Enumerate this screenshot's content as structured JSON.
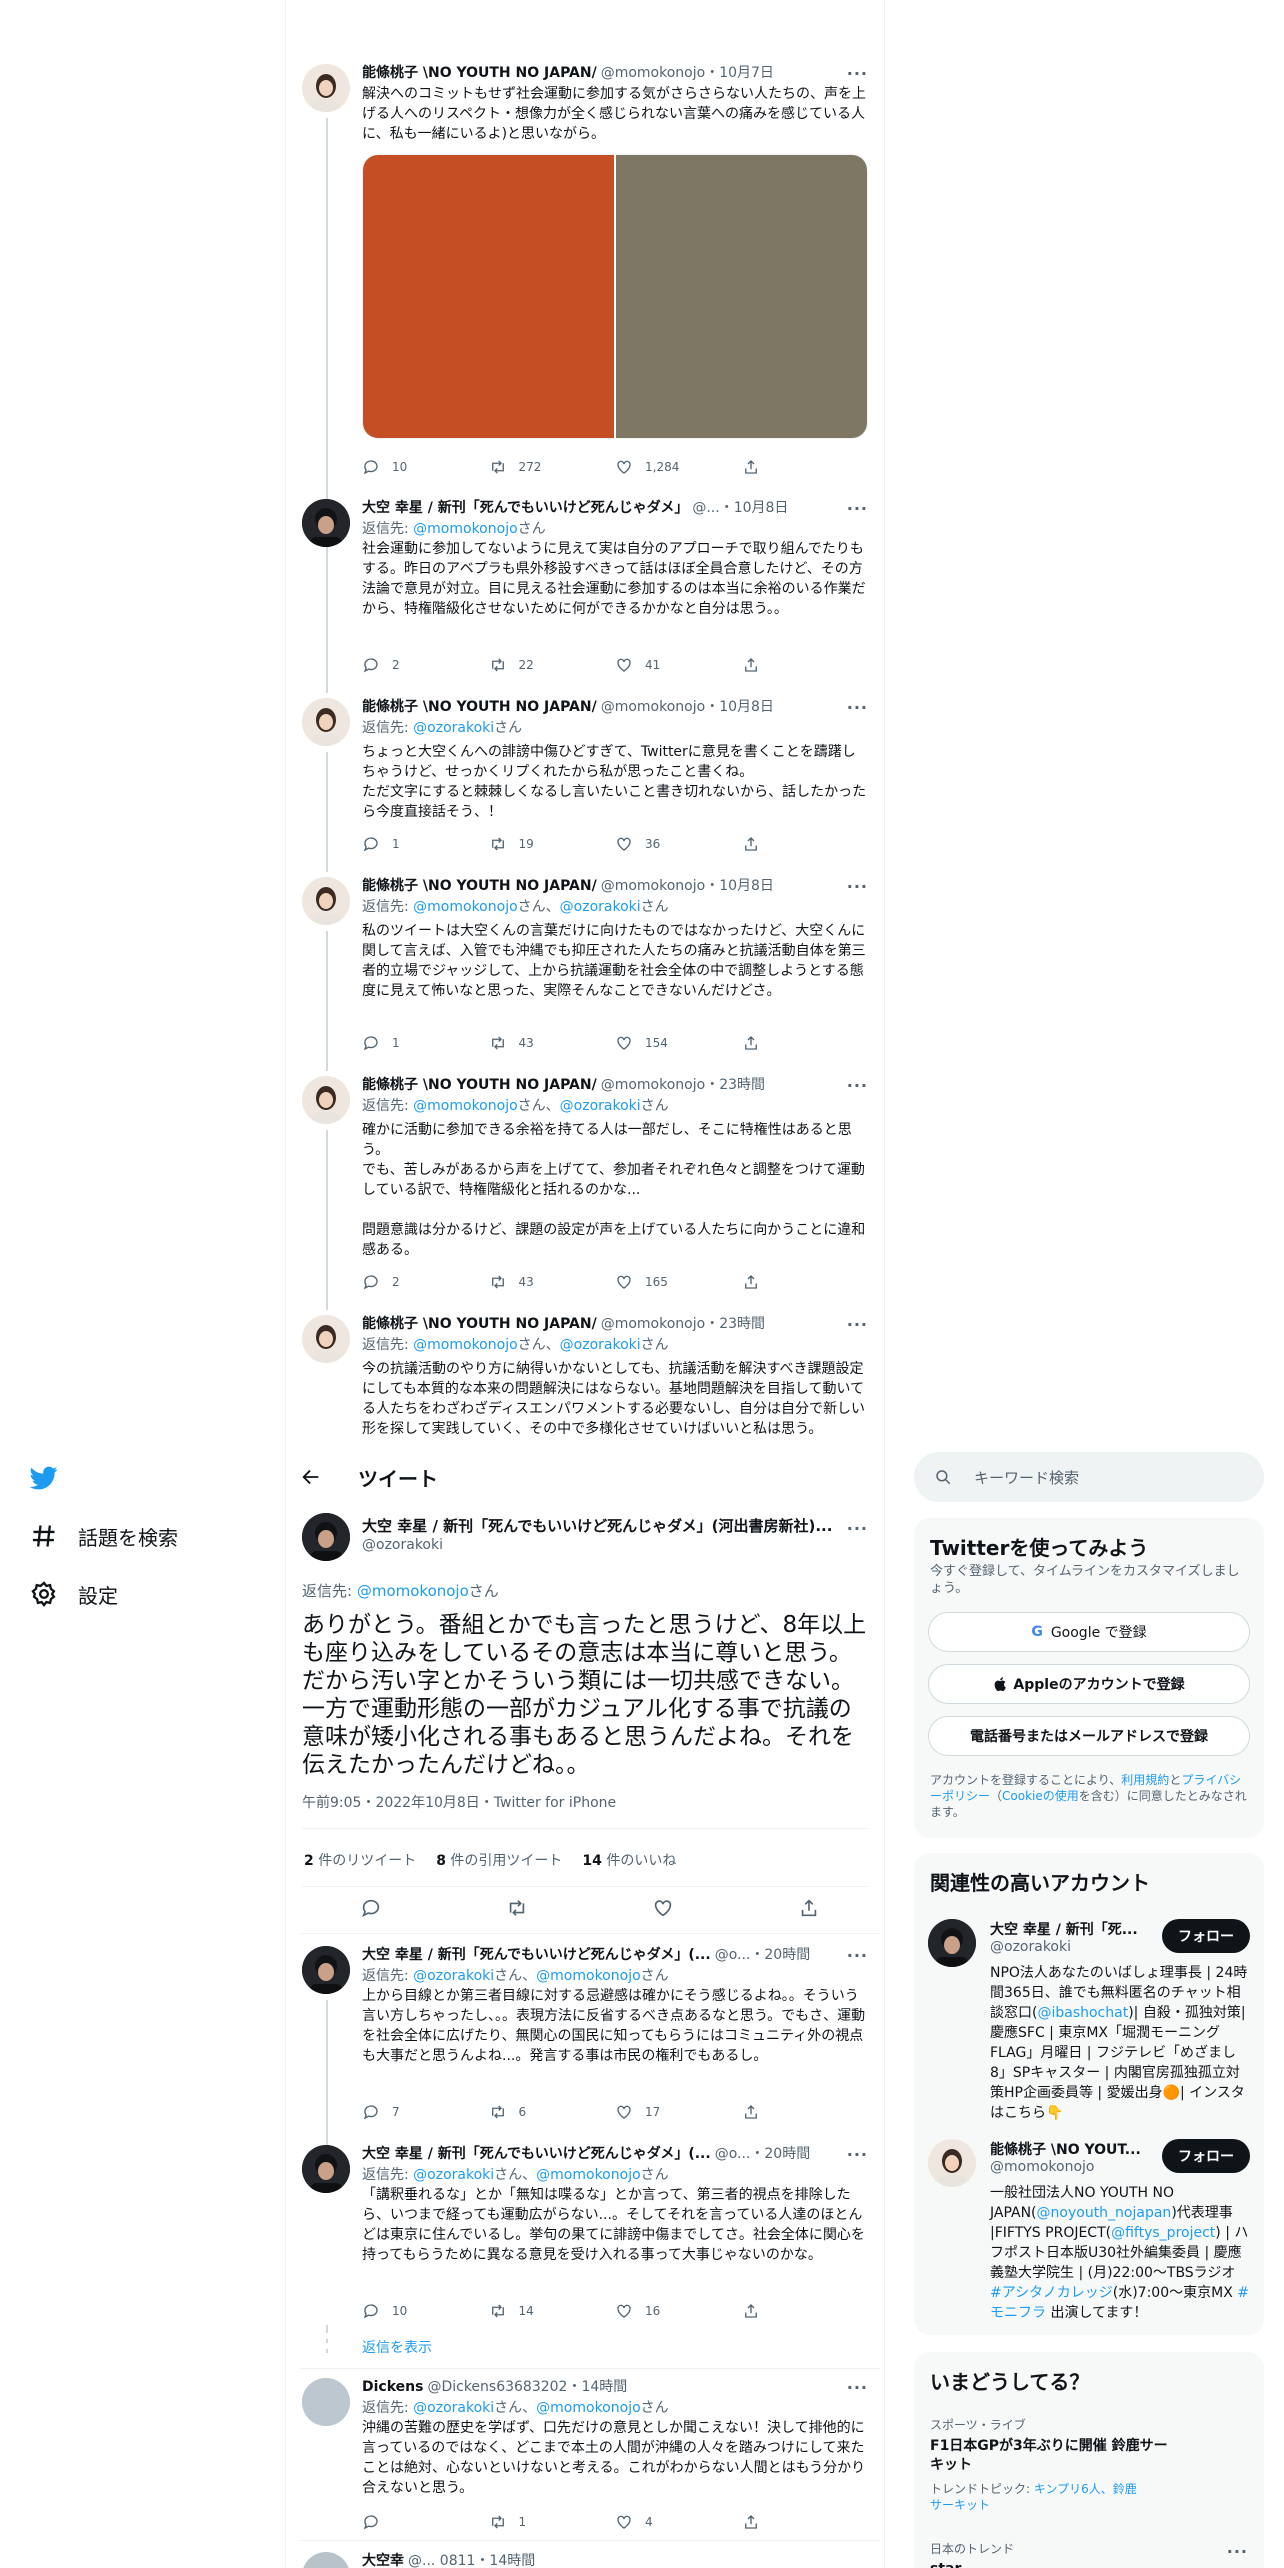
{
  "colors": {
    "accent": "#1d9bf0",
    "text": "#0f1419",
    "muted": "#536471",
    "divider": "#eff3f4",
    "panel": "#f7f9f9",
    "img_left": "#c64e25",
    "img_right": "#7e7764"
  },
  "nav": {
    "items": [
      {
        "icon": "twitter-logo-icon",
        "label": ""
      },
      {
        "icon": "hashtag-icon",
        "label": "話題を検索"
      },
      {
        "icon": "gear-icon",
        "label": "設定"
      }
    ]
  },
  "header": {
    "back_icon": "arrow-left-icon",
    "title": "ツイート"
  },
  "search": {
    "placeholder": "キーワード検索",
    "icon": "search-icon"
  },
  "ancestors": [
    {
      "name": "能條桃子 \\NO YOUTH NO JAPAN/",
      "handle": "@momokonojo",
      "time": "・10月7日",
      "reply": "",
      "reply_to": [],
      "text": "解決へのコミットもせず社会運動に参加する気がさらさらない人たちの、声を上げる人へのリスペクト・想像力が全く感じられない言葉への痛みを感じている人に、私も一緒にいるよ)と思いながら。",
      "replies": "10",
      "retweets": "272",
      "likes": "1,284"
    },
    {
      "name": "大空 幸星 / 新刊「死んでもいいけど死んじゃダメ」",
      "handle": "@...",
      "time": "・10月8日",
      "reply": "返信先:",
      "reply_to": [
        "@momokonojo"
      ],
      "text": "社会運動に参加してないように見えて実は自分のアプローチで取り組んでたりもする。昨日のアベプラも県外移設すべきって話はほぼ全員合意したけど、その方法論で意見が対立。目に見える社会運動に参加するのは本当に余裕のいる作業だから、特権階級化させないために何ができるかかなと自分は思う。。",
      "replies": "2",
      "retweets": "22",
      "likes": "41"
    },
    {
      "name": "能條桃子 \\NO YOUTH NO JAPAN/",
      "handle": "@momokonojo",
      "time": "・10月8日",
      "reply": "返信先:",
      "reply_to": [
        "@ozorakoki"
      ],
      "text": "ちょっと大空くんへの誹謗中傷ひどすぎて、Twitterに意見を書くことを躊躇しちゃうけど、せっかくリプくれたから私が思ったこと書くね。\nただ文字にすると棘棘しくなるし言いたいこと書き切れないから、話したかったら今度直接話そう、！",
      "replies": "1",
      "retweets": "19",
      "likes": "36"
    },
    {
      "name": "能條桃子 \\NO YOUTH NO JAPAN/",
      "handle": "@momokonojo",
      "time": "・10月8日",
      "reply": "返信先:",
      "reply_to": [
        "@momokonojo",
        "@ozorakoki"
      ],
      "text": "私のツイートは大空くんの言葉だけに向けたものではなかったけど、大空くんに関して言えば、入管でも沖縄でも抑圧された人たちの痛みと抗議活動自体を第三者的立場でジャッジして、上から抗議運動を社会全体の中で調整しようとする態度に見えて怖いなと思った、実際そんなことできないんだけどさ。",
      "replies": "1",
      "retweets": "43",
      "likes": "154"
    },
    {
      "name": "能條桃子 \\NO YOUTH NO JAPAN/",
      "handle": "@momokonojo",
      "time": "・23時間",
      "reply": "返信先:",
      "reply_to": [
        "@momokonojo",
        "@ozorakoki"
      ],
      "text": "確かに活動に参加できる余裕を持てる人は一部だし、そこに特権性はあると思う。\nでも、苦しみがあるから声を上げてて、参加者それぞれ色々と調整をつけて運動している訳で、特権階級化と括れるのかな...\n\n問題意識は分かるけど、課題の設定が声を上げている人たちに向かうことに違和感ある。",
      "replies": "2",
      "retweets": "43",
      "likes": "165"
    },
    {
      "name": "能條桃子 \\NO YOUTH NO JAPAN/",
      "handle": "@momokonojo",
      "time": "・23時間",
      "reply": "返信先:",
      "reply_to": [
        "@momokonojo",
        "@ozorakoki"
      ],
      "text": "今の抗議活動のやり方に納得いかないとしても、抗議活動を解決すべき課題設定にしても本質的な本来の問題解決にはならない。基地問題解決を目指して動いてる人たちをわざわざディスエンパワメントする必要ないし、自分は自分で新しい形を探して実践していく、その中で多様化させていけばいいと私は思う。",
      "replies": "",
      "retweets": "",
      "likes": ""
    }
  ],
  "main_tweet": {
    "name": "大空 幸星 / 新刊「死んでもいいけど死んじゃダメ」(河出書房新社)...",
    "handle": "@ozorakoki",
    "reply": "返信先:",
    "reply_to": "@momokonojo",
    "text": "ありがとう。番組とかでも言ったと思うけど、8年以上も座り込みをしているその意志は本当に尊いと思う。だから汚い字とかそういう類には一切共感できない。一方で運動形態の一部がカジュアル化する事で抗議の意味が矮小化される事もあると思うんだよね。それを伝えたかったんだけどね。。",
    "meta": "午前9:05・2022年10月8日・Twitter for iPhone",
    "retweets_n": "2",
    "retweets_l": "件のリツイート",
    "quotes_n": "8",
    "quotes_l": "件の引用ツイート",
    "likes_n": "14",
    "likes_l": "件のいいね"
  },
  "replies": [
    {
      "name": "大空 幸星 / 新刊「死んでもいいけど死んじゃダメ」(...",
      "handle": "@o...",
      "time": "・20時間",
      "reply": "返信先:",
      "reply_to": [
        "@ozorakoki",
        "@momokonojo"
      ],
      "text": "上から目線とか第三者目線に対する忌避感は確かにそう感じるよね。。そういう言い方しちゃったし、。。表現方法に反省するべき点あるなと思う。でもさ、運動を社会全体に広げたり、無関心の国民に知ってもらうにはコミュニティ外の視点も大事だと思うんよね...。発言する事は市民の権利でもあるし。",
      "replies": "7",
      "retweets": "6",
      "likes": "17"
    },
    {
      "name": "大空 幸星 / 新刊「死んでもいいけど死んじゃダメ」(...",
      "handle": "@o...",
      "time": "・20時間",
      "reply": "返信先:",
      "reply_to": [
        "@ozorakoki",
        "@momokonojo"
      ],
      "text": "「講釈垂れるな」とか「無知は喋るな」とか言って、第三者的視点を排除したら、いつまで経っても運動広がらない...。そしてそれを言っている人達のほとんどは東京に住んでいるし。挙句の果てに誹謗中傷までしてさ。社会全体に関心を持ってもらうために異なる意見を受け入れる事って大事じゃないのかな。",
      "replies": "10",
      "retweets": "14",
      "likes": "16"
    },
    {
      "name": "Dickens",
      "handle": "@Dickens63683202",
      "time": "・14時間",
      "reply": "返信先:",
      "reply_to": [
        "@ozorakoki",
        "@momokonojo"
      ],
      "text": "沖縄の苦難の歴史を学ばず、口先だけの意見としか聞こえない！決して排他的に言っているのではなく、どこまで本土の人間が沖縄の人々を踏みつけにして来たことは絶対、心ないといけないと考える。これがわからない人間とはもう分かり合えないと思う。",
      "replies": "",
      "retweets": "1",
      "likes": "4"
    }
  ],
  "show_replies": "返信を表示",
  "partial": {
    "name": "大空幸",
    "handle": "@... 0811",
    "time": "・14時間"
  },
  "signup": {
    "title": "Twitterを使ってみよう",
    "desc": "今すぐ登録して、タイムラインをカスタマイズしましょう。",
    "google": "Google で登録",
    "apple": "Appleのアカウントで登録",
    "phone": "電話番号またはメールアドレスで登録",
    "terms_1": "アカウントを登録することにより、",
    "terms_link1": "利用規約",
    "terms_2": "と",
    "terms_link2": "プライバシーポリシー",
    "terms_3": "（",
    "terms_link3": "Cookieの使用",
    "terms_4": "を含む）に同意したとみなされます。"
  },
  "related": {
    "title": "関連性の高いアカウント",
    "follow": "フォロー",
    "accounts": [
      {
        "name": "大空 幸星 / 新刊「死...",
        "handle": "@ozorakoki",
        "bio": [
          "NPO法人あなたのいばしょ理事長 | 24時間365日、誰でも無料匿名のチャット相談窓口(",
          "@ibashochat",
          ")| 自殺・孤独対策| 慶應SFC | 東京MX「堀潤モーニングFLAG」月曜日 | フジテレビ「めざまし8」SPキャスター | 内閣官房孤独孤立対策HP企画委員等 | 愛媛出身🟠| インスタはこちら👇"
        ]
      },
      {
        "name": "能條桃子 \\NO YOUT...",
        "handle": "@momokonojo",
        "bio": [
          "一般社団法人NO YOUTH NO JAPAN(",
          "@noyouth_nojapan",
          ")代表理事 |FIFTYS PROJECT(",
          "@fiftys_project",
          ") | ハフポスト日本版U30社外編集委員 | 慶應義塾大学院生 | (月)22:00〜TBSラジオ ",
          "#アシタノカレッジ",
          "(水)7:00〜東京MX ",
          "#モニフラ",
          " 出演してます！"
        ]
      }
    ]
  },
  "trends": {
    "title": "いまどうしてる？",
    "items": [
      {
        "cat": "スポーツ・ライブ",
        "title": "F1日本GPが3年ぶりに開催 鈴鹿サーキット",
        "topic_label": "トレンドトピック: ",
        "topic": "キンプリ6人、鈴鹿サーキット"
      },
      {
        "cat": "日本のトレンド",
        "title": "star",
        "topic_label": "",
        "topic": ""
      }
    ]
  }
}
